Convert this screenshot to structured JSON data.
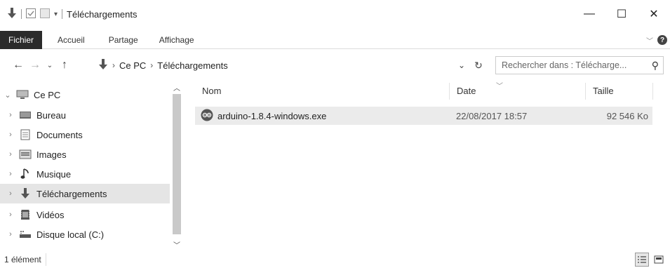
{
  "window": {
    "title": "Téléchargements",
    "minimize_glyph": "—",
    "maximize_glyph": "☐",
    "close_glyph": "✕"
  },
  "ribbon": {
    "tabs": [
      "Fichier",
      "Accueil",
      "Partage",
      "Affichage"
    ]
  },
  "address": {
    "segments": [
      "Ce PC",
      "Téléchargements"
    ],
    "search_placeholder": "Rechercher dans : Télécharge..."
  },
  "nav": {
    "items": [
      {
        "label": "Ce PC",
        "icon": "computer-icon",
        "expanded": true
      },
      {
        "label": "Bureau",
        "icon": "desktop-icon"
      },
      {
        "label": "Documents",
        "icon": "documents-icon"
      },
      {
        "label": "Images",
        "icon": "images-icon"
      },
      {
        "label": "Musique",
        "icon": "music-icon"
      },
      {
        "label": "Téléchargements",
        "icon": "downloads-icon",
        "selected": true
      },
      {
        "label": "Vidéos",
        "icon": "videos-icon"
      },
      {
        "label": "Disque local (C:)",
        "icon": "drive-icon"
      }
    ]
  },
  "files": {
    "columns": {
      "name": "Nom",
      "date": "Date",
      "size": "Taille"
    },
    "rows": [
      {
        "name": "arduino-1.8.4-windows.exe",
        "date": "22/08/2017 18:57",
        "size": "92 546 Ko",
        "icon": "arduino-icon"
      }
    ]
  },
  "status": {
    "count_text": "1 élément"
  }
}
